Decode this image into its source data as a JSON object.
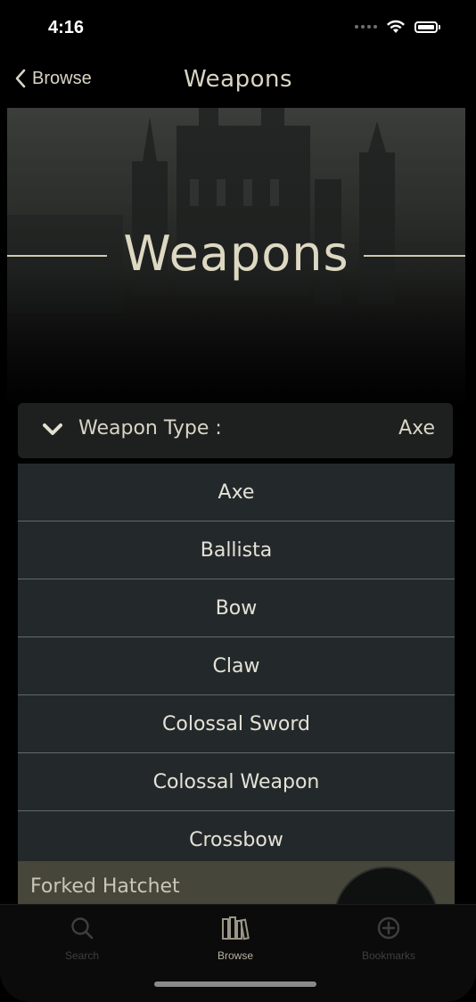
{
  "status_bar": {
    "time": "4:16"
  },
  "nav": {
    "back_label": "Browse",
    "title": "Weapons"
  },
  "hero": {
    "title": "Weapons"
  },
  "filter": {
    "label": "Weapon Type :",
    "value": "Axe"
  },
  "options": [
    "Axe",
    "Ballista",
    "Bow",
    "Claw",
    "Colossal Sword",
    "Colossal Weapon",
    "Crossbow"
  ],
  "result": {
    "name": "Forked Hatchet"
  },
  "tabs": {
    "search": "Search",
    "browse": "Browse",
    "bookmarks": "Bookmarks"
  },
  "colors": {
    "accent": "#d9d5c5",
    "option_bg": "#23292a",
    "tab_active": "#b5b1a2",
    "tab_inactive": "#3f3f3f"
  }
}
